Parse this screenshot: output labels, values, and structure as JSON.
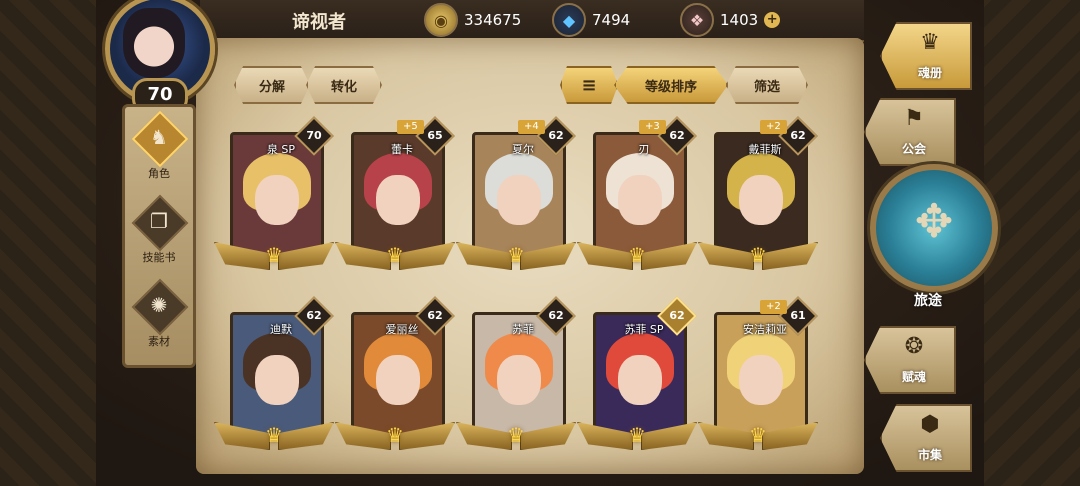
{
  "player": {
    "name": "谛视者",
    "level": "70"
  },
  "resources": [
    {
      "name": "gold",
      "icon": "coin-icon",
      "value": "334675"
    },
    {
      "name": "crystal",
      "icon": "blue-crystal-icon",
      "value": "7494"
    },
    {
      "name": "gem",
      "icon": "pink-gem-icon",
      "value": "1403"
    }
  ],
  "side_nav": [
    {
      "label": "角色",
      "icon": "character-icon",
      "active": true
    },
    {
      "label": "技能书",
      "icon": "skill-book-icon",
      "active": false
    },
    {
      "label": "素材",
      "icon": "material-icon",
      "active": false
    }
  ],
  "toolbar": {
    "dismantle": "分解",
    "convert": "转化",
    "sort_icon": "sort-icon",
    "sort_label": "等级排序",
    "filter": "筛选"
  },
  "cards": [
    {
      "name": "泉 SP",
      "level": "70",
      "stars": "",
      "hair": "#e8c068",
      "bg": "#6a3a3a",
      "max": false
    },
    {
      "name": "蕾卡",
      "level": "65",
      "stars": "+5",
      "hair": "#b8424a",
      "bg": "#5a3a2a",
      "max": false
    },
    {
      "name": "夏尔",
      "level": "62",
      "stars": "+4",
      "hair": "#dcdcd8",
      "bg": "#a8845a",
      "max": false
    },
    {
      "name": "刃",
      "level": "62",
      "stars": "+3",
      "hair": "#ede2d4",
      "bg": "#8a5a3a",
      "max": false
    },
    {
      "name": "戴菲斯",
      "level": "62",
      "stars": "+2",
      "hair": "#d4b34a",
      "bg": "#3a2a20",
      "max": false
    },
    {
      "name": "迪默",
      "level": "62",
      "stars": "",
      "hair": "#4a3224",
      "bg": "#4a5a7a",
      "max": false
    },
    {
      "name": "爱丽丝",
      "level": "62",
      "stars": "",
      "hair": "#e08a3a",
      "bg": "#7a4a2a",
      "max": false
    },
    {
      "name": "苏菲",
      "level": "62",
      "stars": "",
      "hair": "#f08a4a",
      "bg": "#c8b8a8",
      "max": false
    },
    {
      "name": "苏菲 SP",
      "level": "62",
      "stars": "",
      "hair": "#e04a3a",
      "bg": "#3a2a5a",
      "max": true
    },
    {
      "name": "安洁莉亚",
      "level": "61",
      "stars": "+2",
      "hair": "#f0d278",
      "bg": "#c8a05a",
      "max": false
    }
  ],
  "right_nav": [
    {
      "label": "魂册",
      "icon": "soul-book-icon",
      "active": true
    },
    {
      "label": "公会",
      "icon": "guild-icon",
      "active": false
    },
    {
      "label": "旅途",
      "icon": "journey-emblem-icon",
      "active": false
    },
    {
      "label": "赋魂",
      "icon": "soul-bind-icon",
      "active": false
    },
    {
      "label": "市集",
      "icon": "market-icon",
      "active": false
    }
  ]
}
